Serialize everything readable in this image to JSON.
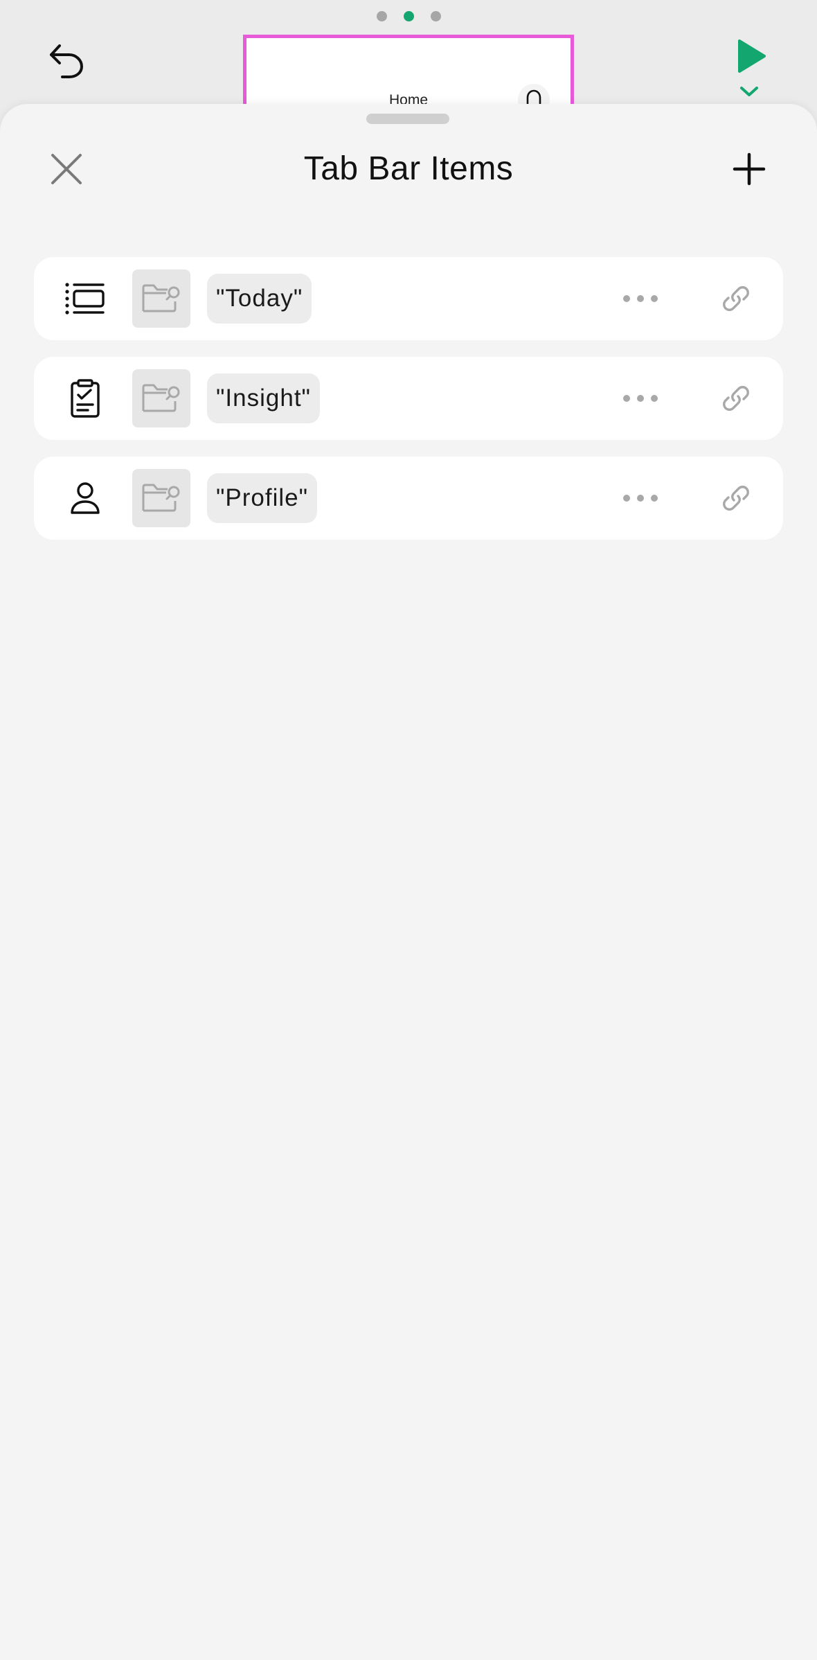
{
  "colors": {
    "accent": "#14a66f",
    "selection_border": "#e75ad8",
    "sheet_background": "#f4f4f5",
    "row_background": "#ffffff",
    "muted_icon": "#a8a8a8"
  },
  "pager": {
    "count": 3,
    "active_index": 1
  },
  "toolbar": {
    "undo_icon": "undo-icon",
    "play_icon": "play-icon",
    "run_menu_icon": "chevron-down-icon"
  },
  "preview": {
    "title": "Home",
    "bell_icon": "bell-icon"
  },
  "sheet": {
    "title": "Tab Bar Items",
    "close_icon": "close-icon",
    "add_icon": "plus-icon"
  },
  "tab_items": [
    {
      "icon": "list-icon",
      "label": "\"Today\""
    },
    {
      "icon": "clipboard-check-icon",
      "label": "\"Insight\""
    },
    {
      "icon": "person-icon",
      "label": "\"Profile\""
    }
  ]
}
